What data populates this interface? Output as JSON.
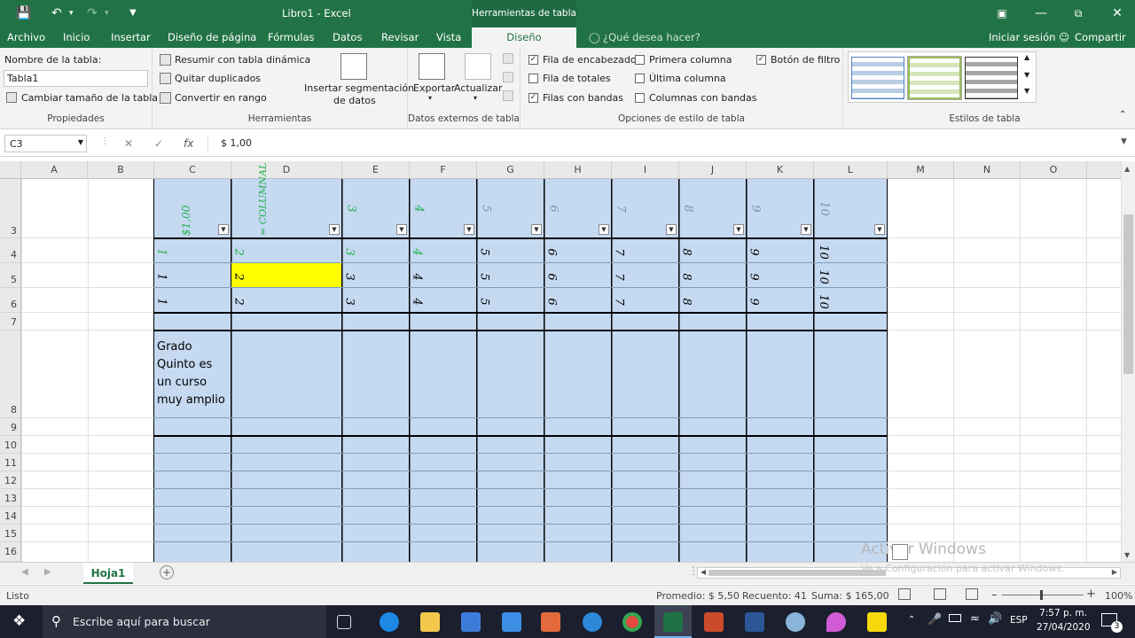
{
  "titlebar": {
    "doc_title": "Libro1 - Excel",
    "context_group": "Herramientas de tabla",
    "icons": [
      "save-icon",
      "undo-icon",
      "redo-icon",
      "customize-icon",
      "ribbon-display-icon",
      "minimize-icon",
      "restore-icon",
      "close-icon"
    ]
  },
  "ribbon_tabs": {
    "archivo": "Archivo",
    "inicio": "Inicio",
    "insertar": "Insertar",
    "diseno_pagina": "Diseño de página",
    "formulas": "Fórmulas",
    "datos": "Datos",
    "revisar": "Revisar",
    "vista": "Vista",
    "diseno": "Diseño",
    "tell_me": "¿Qué desea hacer?",
    "sign_in": "Iniciar sesión",
    "share": "Compartir"
  },
  "ribbon": {
    "propiedades": {
      "name_label": "Nombre de la tabla:",
      "name_value": "Tabla1",
      "resize": "Cambiar tamaño de la tabla",
      "group": "Propiedades"
    },
    "herramientas": {
      "pivot": "Resumir con tabla dinámica",
      "remove_dup": "Quitar duplicados",
      "convert": "Convertir en rango",
      "slicer_1": "Insertar segmentación",
      "slicer_2": "de datos",
      "group": "Herramientas"
    },
    "externos": {
      "export": "Exportar",
      "refresh": "Actualizar",
      "group": "Datos externos de tabla"
    },
    "opciones": {
      "header_row": "Fila de encabezado",
      "total_row": "Fila de totales",
      "banded_rows": "Filas con bandas",
      "first_col": "Primera columna",
      "last_col": "Última columna",
      "banded_cols": "Columnas con bandas",
      "filter_btn": "Botón de filtro",
      "group": "Opciones de estilo de tabla"
    },
    "estilos": {
      "group": "Estilos de tabla"
    }
  },
  "formula_bar": {
    "name_box": "C3",
    "cancel": "✕",
    "enter": "✓",
    "fx": "fx",
    "formula": "$ 1,00"
  },
  "columns": [
    "A",
    "B",
    "C",
    "D",
    "E",
    "F",
    "G",
    "H",
    "I",
    "J",
    "K",
    "L",
    "M",
    "N",
    "O"
  ],
  "rows": [
    "3",
    "4",
    "5",
    "6",
    "7",
    "8",
    "9",
    "10",
    "11",
    "12",
    "13",
    "14",
    "15",
    "16"
  ],
  "cells": {
    "header_c": "$1,00",
    "header_d": "= COLUMNAL",
    "header_e": "3",
    "header_f": "4",
    "header_g": "5",
    "header_h": "6",
    "header_i": "7",
    "header_j": "8",
    "header_k": "9",
    "header_l": "10",
    "row4": [
      "1",
      "2",
      "3",
      "4",
      "5",
      "6",
      "7",
      "8",
      "9",
      "10"
    ],
    "row5": [
      "1",
      "2",
      "3",
      "4",
      "5",
      "6",
      "7",
      "8",
      "9",
      "10"
    ],
    "row6": [
      "1",
      "2",
      "3",
      "4",
      "5",
      "6",
      "7",
      "8",
      "9",
      "10"
    ],
    "c8_line1": "Grado",
    "c8_line2": "Quinto es",
    "c8_line3": "un curso",
    "c8_line4": "muy amplio"
  },
  "sheet_tabs": {
    "active": "Hoja1",
    "add": "+"
  },
  "status_bar": {
    "mode": "Listo",
    "promedio": "Promedio: $ 5,50",
    "recuento": "Recuento: 41",
    "suma": "Suma:  $ 165,00",
    "zoom": "100%"
  },
  "watermark": {
    "line1": "Activar Windows",
    "line2": "Ve a Configuración para activar Windows."
  },
  "taskbar": {
    "search_placeholder": "Escribe aquí para buscar",
    "lang": "ESP",
    "time": "7:57 p. m.",
    "date": "27/04/2020",
    "notif_count": "3"
  },
  "colors": {
    "excel_green": "#217346",
    "table_fill": "#c5d9f1",
    "selected_yellow": "#ffff00",
    "glyph_green": "#22b14c"
  }
}
